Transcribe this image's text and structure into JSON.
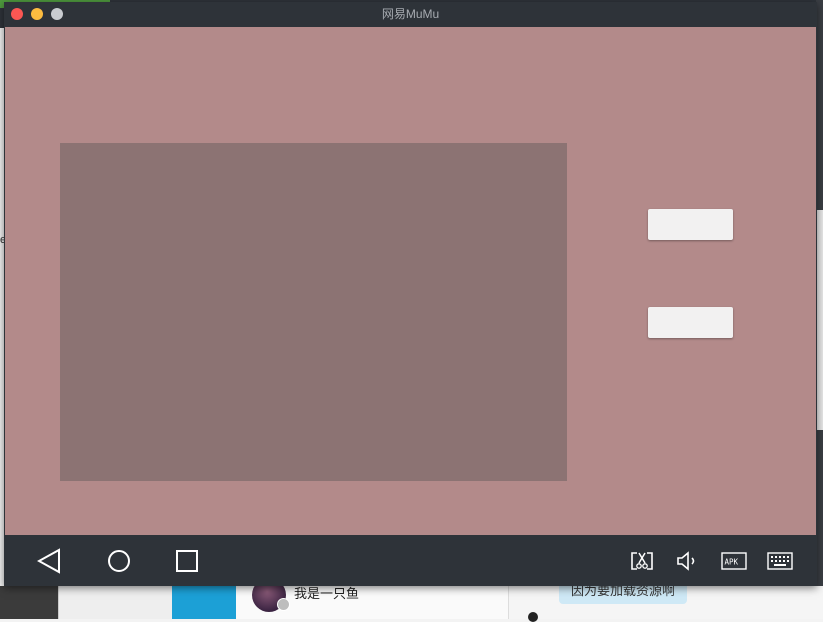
{
  "window": {
    "title": "网易MuMu"
  },
  "app": {
    "button_1_label": "",
    "button_2_label": ""
  },
  "navbar": {
    "left": [
      "back-icon",
      "home-icon",
      "recents-icon"
    ],
    "right": [
      "screenshot-cut-icon",
      "volume-icon",
      "apk-icon",
      "keyboard-icon"
    ],
    "apk_text": "APK"
  },
  "background": {
    "contact_name": "我是一只鱼",
    "chat_bubble": "因为要加载资源啊",
    "left_fragment": "e"
  },
  "colors": {
    "screen_bg": "#b38a8a",
    "panel_bg": "#8c7373",
    "chrome": "#2e3339"
  }
}
